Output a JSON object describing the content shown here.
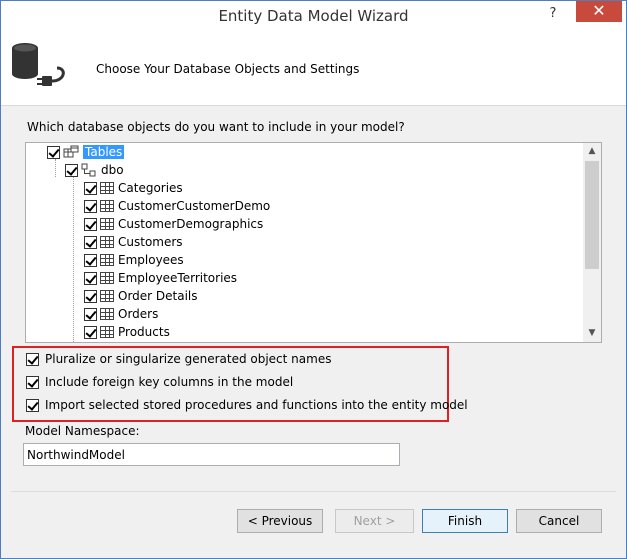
{
  "window": {
    "title": "Entity Data Model Wizard",
    "help_glyph": "?",
    "close_glyph": "✕"
  },
  "header": {
    "title": "Choose Your Database Objects and Settings"
  },
  "question": "Which database objects do you want to include in your model?",
  "tree": {
    "root": {
      "label": "Tables",
      "checked": true
    },
    "schema": {
      "label": "dbo",
      "checked": true
    },
    "tables": [
      {
        "label": "Categories",
        "checked": true
      },
      {
        "label": "CustomerCustomerDemo",
        "checked": true
      },
      {
        "label": "CustomerDemographics",
        "checked": true
      },
      {
        "label": "Customers",
        "checked": true
      },
      {
        "label": "Employees",
        "checked": true
      },
      {
        "label": "EmployeeTerritories",
        "checked": true
      },
      {
        "label": "Order Details",
        "checked": true
      },
      {
        "label": "Orders",
        "checked": true
      },
      {
        "label": "Products",
        "checked": true
      }
    ]
  },
  "options": [
    {
      "label": "Pluralize or singularize generated object names",
      "checked": true
    },
    {
      "label": "Include foreign key columns in the model",
      "checked": true
    },
    {
      "label": "Import selected stored procedures and functions into the entity model",
      "checked": true
    }
  ],
  "namespace": {
    "label": "Model Namespace:",
    "value": "NorthwindModel"
  },
  "buttons": {
    "previous": "< Previous",
    "next": "Next >",
    "finish": "Finish",
    "cancel": "Cancel"
  },
  "colors": {
    "selection": "#3399ff",
    "close_button": "#c74a3c",
    "highlight_border": "#e02020"
  }
}
